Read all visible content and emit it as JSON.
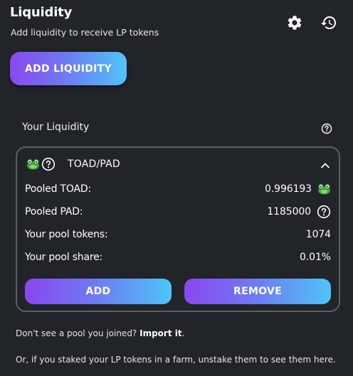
{
  "header": {
    "title": "Liquidity",
    "subtitle": "Add liquidity to receive LP tokens",
    "settings_icon": "gear-icon",
    "history_icon": "history-icon"
  },
  "add_liquidity_label": "ADD LIQUIDITY",
  "your_liquidity": {
    "heading": "Your Liquidity",
    "help_icon": "question-circle-icon"
  },
  "pool": {
    "pair": "TOAD/PAD",
    "token_icons": [
      "toad-icon",
      "question-circle-icon"
    ],
    "rows": [
      {
        "label": "Pooled TOAD:",
        "value": "0.996193",
        "icon": "toad-icon"
      },
      {
        "label": "Pooled PAD:",
        "value": "1185000",
        "icon": "question-circle-icon"
      },
      {
        "label": "Your pool tokens:",
        "value": "1074"
      },
      {
        "label": "Your pool share:",
        "value": "0.01%"
      }
    ],
    "add_label": "ADD",
    "remove_label": "REMOVE"
  },
  "notes": {
    "pool_missing_text": "Don't see a pool you joined? ",
    "import_link": "Import it",
    "pool_missing_end": ".",
    "staked_text": "Or, if you staked your LP tokens in a farm, unstake them to see them here."
  },
  "colors": {
    "background": "#212429",
    "gradient_start": "#8a47f0",
    "gradient_end": "#4fc4f7",
    "card_border": "#5c5f66"
  }
}
